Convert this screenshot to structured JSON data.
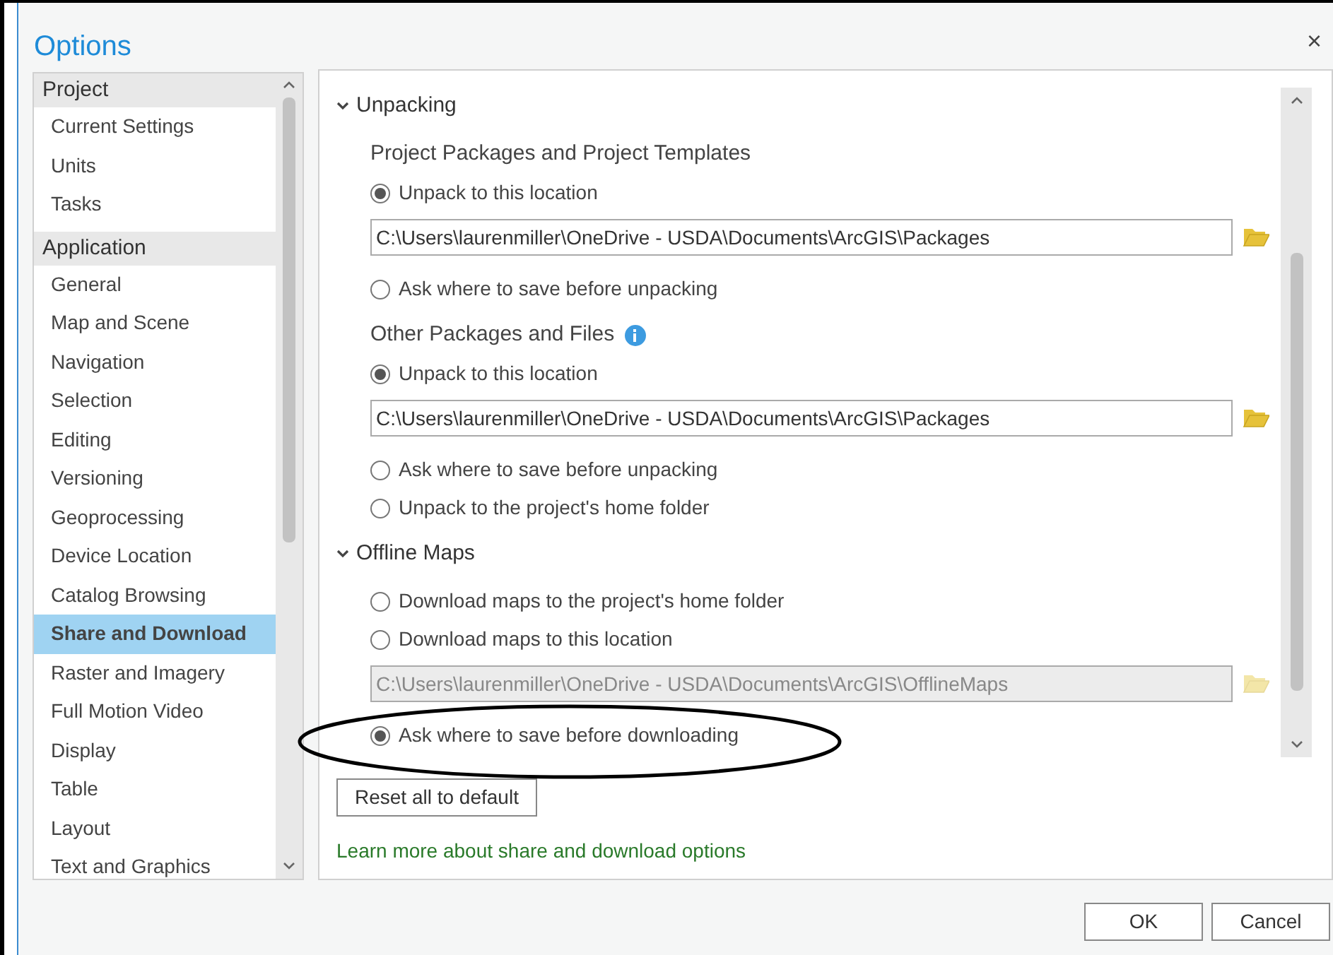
{
  "window": {
    "title": "Options",
    "close": "×"
  },
  "sidebar": {
    "groups": [
      {
        "label": "Project",
        "items": [
          {
            "label": "Current Settings",
            "selected": false
          },
          {
            "label": "Units",
            "selected": false
          },
          {
            "label": "Tasks",
            "selected": false
          }
        ]
      },
      {
        "label": "Application",
        "items": [
          {
            "label": "General",
            "selected": false
          },
          {
            "label": "Map and Scene",
            "selected": false
          },
          {
            "label": "Navigation",
            "selected": false
          },
          {
            "label": "Selection",
            "selected": false
          },
          {
            "label": "Editing",
            "selected": false
          },
          {
            "label": "Versioning",
            "selected": false
          },
          {
            "label": "Geoprocessing",
            "selected": false
          },
          {
            "label": "Device Location",
            "selected": false
          },
          {
            "label": "Catalog Browsing",
            "selected": false
          },
          {
            "label": "Share and Download",
            "selected": true
          },
          {
            "label": "Raster and Imagery",
            "selected": false
          },
          {
            "label": "Full Motion Video",
            "selected": false
          },
          {
            "label": "Display",
            "selected": false
          },
          {
            "label": "Table",
            "selected": false
          },
          {
            "label": "Layout",
            "selected": false
          },
          {
            "label": "Text and Graphics",
            "selected": false
          }
        ]
      }
    ]
  },
  "sections": [
    {
      "title": "Unpacking",
      "expanded": true,
      "items": [
        {
          "kind": "heading",
          "label": "Project Packages and Project Templates",
          "info": false
        },
        {
          "kind": "radio",
          "label": "Unpack to this location",
          "selected": true
        },
        {
          "kind": "path",
          "value": "C:\\Users\\laurenmiller\\OneDrive - USDA\\Documents\\ArcGIS\\Packages",
          "disabled": false
        },
        {
          "kind": "radio",
          "label": "Ask where to save before unpacking",
          "selected": false
        },
        {
          "kind": "heading",
          "label": "Other Packages and Files",
          "info": true
        },
        {
          "kind": "radio",
          "label": "Unpack to this location",
          "selected": true
        },
        {
          "kind": "path",
          "value": "C:\\Users\\laurenmiller\\OneDrive - USDA\\Documents\\ArcGIS\\Packages",
          "disabled": false
        },
        {
          "kind": "radio",
          "label": "Ask where to save before unpacking",
          "selected": false
        },
        {
          "kind": "radio",
          "label": "Unpack to the project's home folder",
          "selected": false
        }
      ]
    },
    {
      "title": "Offline Maps",
      "expanded": true,
      "items": [
        {
          "kind": "radio",
          "label": "Download maps to the project's home folder",
          "selected": false
        },
        {
          "kind": "radio",
          "label": "Download maps to this location",
          "selected": false
        },
        {
          "kind": "path",
          "value": "C:\\Users\\laurenmiller\\OneDrive - USDA\\Documents\\ArcGIS\\OfflineMaps",
          "disabled": true
        },
        {
          "kind": "radio",
          "label": "Ask where to save before downloading",
          "selected": true
        }
      ]
    }
  ],
  "reset_button": "Reset all to default",
  "help_link": "Learn more about share and download options",
  "buttons": [
    "OK",
    "Cancel"
  ]
}
